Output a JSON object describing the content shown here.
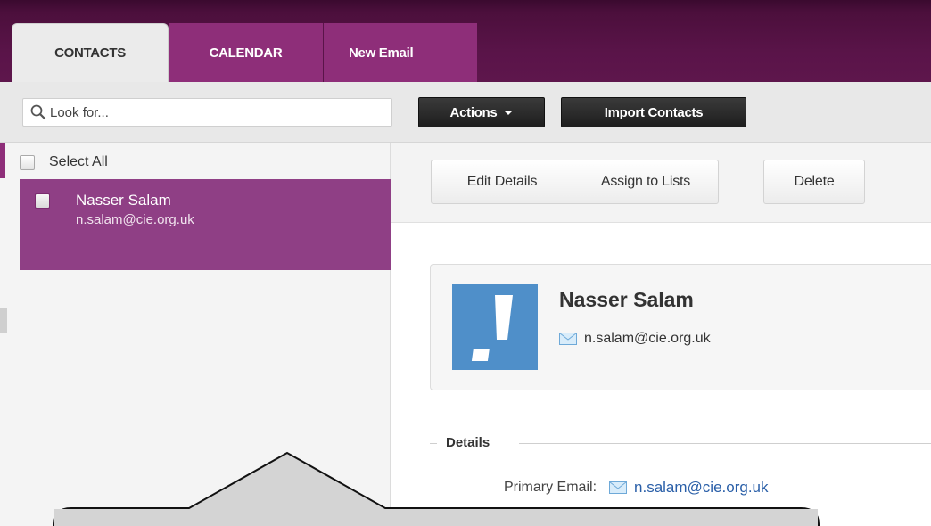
{
  "tabs": [
    {
      "label": "CONTACTS"
    },
    {
      "label": "CALENDAR"
    },
    {
      "label": "New Email"
    }
  ],
  "toolbar": {
    "search_placeholder": "Look for...",
    "actions_label": "Actions",
    "import_label": "Import Contacts"
  },
  "sidebar": {
    "select_all_label": "Select All",
    "contacts": [
      {
        "name": "Nasser Salam",
        "email": "n.salam@cie.org.uk"
      }
    ]
  },
  "main": {
    "buttons": {
      "edit": "Edit Details",
      "assign": "Assign to Lists",
      "delete": "Delete"
    },
    "card": {
      "name": "Nasser Salam",
      "email": "n.salam@cie.org.uk"
    },
    "details": {
      "title": "Details",
      "primary_email_label": "Primary Email:",
      "primary_email_value": "n.salam@cie.org.uk"
    }
  },
  "colors": {
    "brand_purple_dark": "#5a1449",
    "tab_purple": "#8e2e79",
    "selected_row": "#8f3f85",
    "link_blue": "#2a5fa8",
    "avatar_blue": "#4f8fc9"
  },
  "icons": [
    "search-icon",
    "chevron-down-icon",
    "mail-icon",
    "avatar-placeholder-icon"
  ]
}
